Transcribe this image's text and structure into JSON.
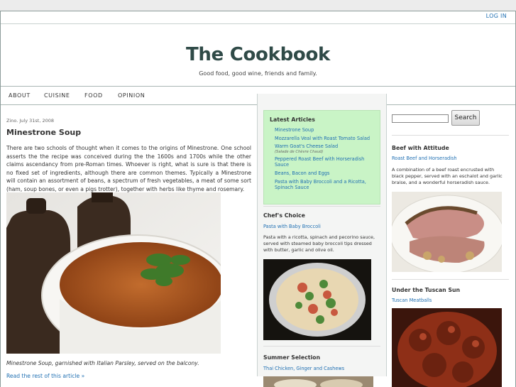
{
  "header": {
    "login": "LOG IN",
    "title": "The Cookbook",
    "tagline": "Good food, good wine, friends and family."
  },
  "nav": [
    "ABOUT",
    "CUISINE",
    "FOOD",
    "OPINION"
  ],
  "post": {
    "meta": "Zino. July 31st, 2008",
    "title": "Minestrone Soup",
    "excerpt": "There are two schools of thought when it comes to the origins of Minestrone. One school asserts the the recipe was conceived during the the 1600s and 1700s while the other claims ascendancy from pre-Roman times. Whoever is right, what is sure is that there is no fixed set of ingredients, although there are common themes. Typically a Minestrone will contain an assortment of beans, a spectrum of fresh vegetables, a meat of some sort (ham, soup bones, or even a pigs trotter), together with herbs like thyme and rosemary.",
    "caption": "Minestrone Soup, garnished with Italian Parsley, served on the balcony.",
    "read_more": "Read the rest of this article »"
  },
  "latest": {
    "heading": "Latest Articles",
    "items": [
      {
        "label": "Minestrone Soup"
      },
      {
        "label": "Mozzarella Veal with Roast Tomato Salad"
      },
      {
        "label": "Warm Goat's Cheese Salad",
        "sub": "(Salade de Chèvre Chaud)"
      },
      {
        "label": "Peppered Roast Beef with Horseradish Sauce"
      },
      {
        "label": "Beans, Bacon and Eggs"
      },
      {
        "label": "Pasta with Baby Broccoli and a Ricotta, Spinach Sauce"
      }
    ]
  },
  "chefs_choice": {
    "heading": "Chef's Choice",
    "link": "Pasta with Baby Broccoli",
    "text": "Pasta with a ricotta, spinach and pecorino sauce, served with steamed baby broccoli tips dressed with butter, garlic and olive oil."
  },
  "summer": {
    "heading": "Summer Selection",
    "link": "Thai Chicken, Ginger and Cashews"
  },
  "search": {
    "button": "Search"
  },
  "beef": {
    "heading": "Beef with Attitude",
    "link": "Roast Beef and Horseradish",
    "text": "A combination of a beef roast encrusted with black pepper, served with an eschalot and garlic braise, and a wonderful horseradish sauce."
  },
  "tuscan": {
    "heading": "Under the Tuscan Sun",
    "link": "Tuscan Meatballs"
  }
}
